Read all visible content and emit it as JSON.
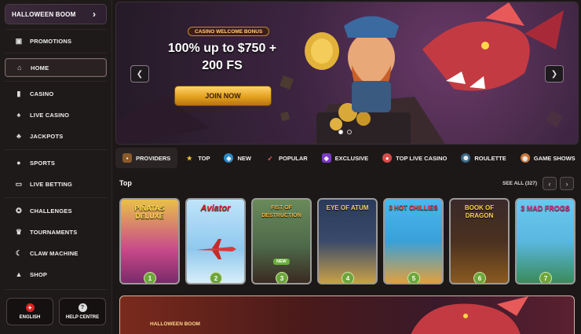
{
  "sidebar": {
    "promo_label": "HALLOWEEN BOOM",
    "items": [
      {
        "label": "PROMOTIONS",
        "icon": "gift-icon"
      },
      {
        "label": "HOME",
        "icon": "home-icon"
      },
      {
        "label": "CASINO",
        "icon": "slot-icon"
      },
      {
        "label": "LIVE CASINO",
        "icon": "cards-icon"
      },
      {
        "label": "JACKPOTS",
        "icon": "clover-icon"
      },
      {
        "label": "SPORTS",
        "icon": "ball-icon"
      },
      {
        "label": "LIVE BETTING",
        "icon": "live-icon"
      },
      {
        "label": "CHALLENGES",
        "icon": "medal-icon"
      },
      {
        "label": "TOURNAMENTS",
        "icon": "trophy-icon"
      },
      {
        "label": "CLAW MACHINE",
        "icon": "claw-icon"
      },
      {
        "label": "SHOP",
        "icon": "bag-icon"
      }
    ],
    "language_label": "ENGLISH",
    "help_label": "HELP CENTRE"
  },
  "hero": {
    "badge": "CASINO WELCOME BONUS",
    "headline": "100% up to $750 + 200 FS",
    "cta": "JOIN NOW"
  },
  "categories": [
    {
      "label": "PROVIDERS",
      "icon": "chest-icon"
    },
    {
      "label": "TOP",
      "icon": "star-icon"
    },
    {
      "label": "NEW",
      "icon": "gem-icon"
    },
    {
      "label": "POPULAR",
      "icon": "rocket-icon"
    },
    {
      "label": "EXCLUSIVE",
      "icon": "diamond-icon"
    },
    {
      "label": "TOP LIVE CASINO",
      "icon": "roulette-chip-icon"
    },
    {
      "label": "ROULETTE",
      "icon": "wheel-icon"
    },
    {
      "label": "GAME SHOWS",
      "icon": "show-icon"
    }
  ],
  "top_section": {
    "title": "Top",
    "see_all": "SEE ALL (327)"
  },
  "games": [
    {
      "title": "PIÑATAS DELUXE",
      "rank": "1",
      "bg": "#c89a3a"
    },
    {
      "title": "Aviator",
      "rank": "2",
      "bg": "#8fc8ee"
    },
    {
      "title": "FIST OF DESTRUCTION",
      "rank": "3",
      "bg": "#4e6a4a",
      "badge": "NEW"
    },
    {
      "title": "EYE OF ATUM",
      "rank": "4",
      "bg": "#3a4a6a"
    },
    {
      "title": "3 HOT CHILLIES",
      "rank": "5",
      "bg": "#3aa0d8"
    },
    {
      "title": "BOOK OF DRAGON",
      "rank": "6",
      "bg": "#3a2a2a"
    },
    {
      "title": "3 MAD FROGS",
      "rank": "7",
      "bg": "#5ab8e0"
    }
  ],
  "promo2": {
    "label": "HALLOWEEN BOOM"
  },
  "colors": {
    "accent": "#e3a21f",
    "rank_green": "#6da63a"
  }
}
